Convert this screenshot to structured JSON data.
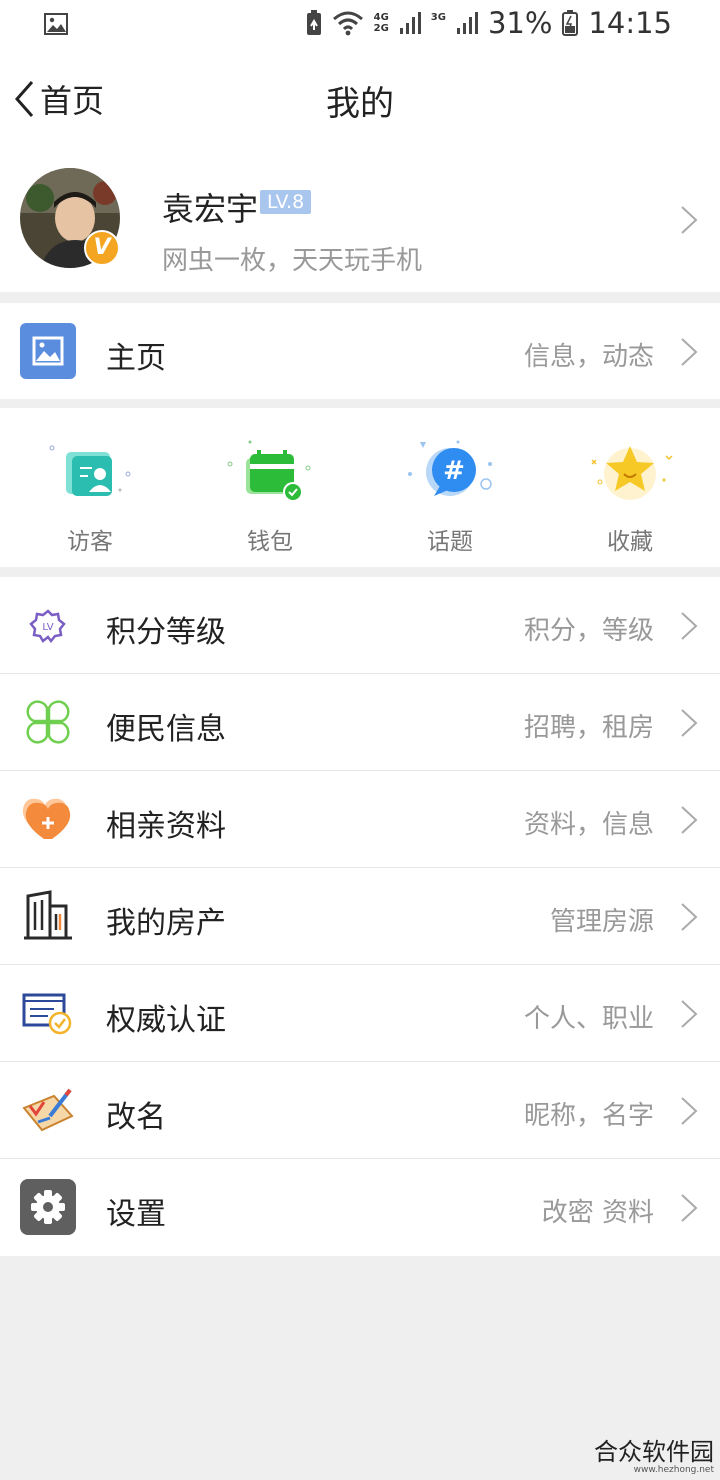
{
  "status_bar": {
    "net_top": "4G",
    "net_bottom": "2G",
    "net2": "3G",
    "battery": "31%",
    "time": "14:15"
  },
  "nav": {
    "back_label": "首页",
    "title": "我的"
  },
  "profile": {
    "name": "袁宏宇",
    "level": "LV.8",
    "bio": "网虫一枚，天天玩手机",
    "verified_badge": "V"
  },
  "home_row": {
    "label": "主页",
    "sub": "信息，动态"
  },
  "quick_actions": [
    {
      "label": "访客",
      "icon": "visitor-icon"
    },
    {
      "label": "钱包",
      "icon": "wallet-icon"
    },
    {
      "label": "话题",
      "icon": "topic-icon"
    },
    {
      "label": "收藏",
      "icon": "star-icon"
    }
  ],
  "menu": [
    {
      "label": "积分等级",
      "sub": "积分，等级",
      "icon": "level-badge-icon"
    },
    {
      "label": "便民信息",
      "sub": "招聘，租房",
      "icon": "clover-icon"
    },
    {
      "label": "相亲资料",
      "sub": "资料，信息",
      "icon": "heart-plus-icon"
    },
    {
      "label": "我的房产",
      "sub": "管理房源",
      "icon": "building-icon"
    },
    {
      "label": "权威认证",
      "sub": "个人、职业",
      "icon": "certificate-icon"
    },
    {
      "label": "改名",
      "sub": "昵称，名字",
      "icon": "edit-icon"
    },
    {
      "label": "设置",
      "sub": "改密 资料",
      "icon": "gear-icon"
    }
  ],
  "watermark": {
    "main": "合众软件园",
    "sub": "www.hezhong.net"
  },
  "colors": {
    "home_icon_bg": "#5b8ddf",
    "level_badge": "#a9c6ee",
    "verified_badge": "#f4a623",
    "settings_icon_bg": "#5f5f5f"
  }
}
